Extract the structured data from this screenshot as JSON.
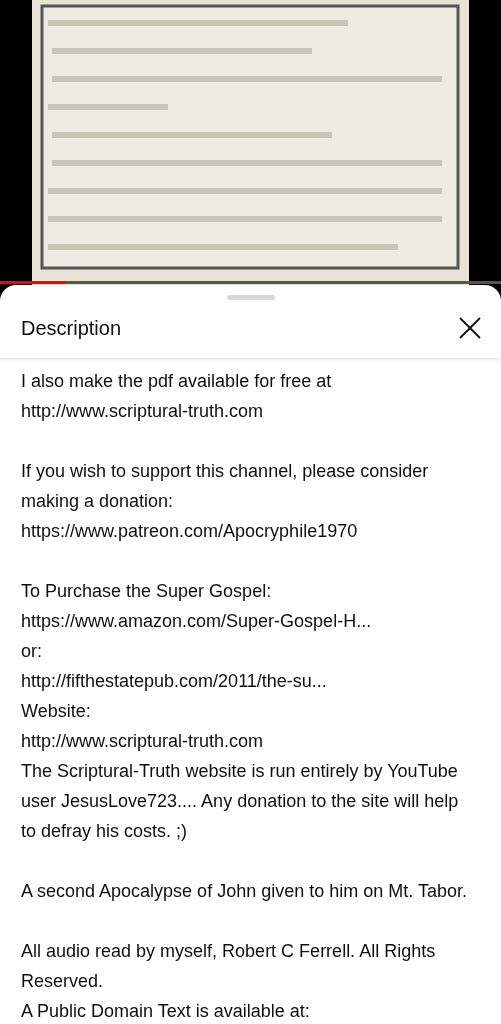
{
  "video": {
    "kind": "picture",
    "progress": {
      "level": 0.13
    }
  },
  "sheet": {
    "title": "Description",
    "paragraphs": [
      [
        "I also make the pdf available for free at",
        "http://www.scriptural-truth.com"
      ],
      [
        "If you wish to support this channel, please consider",
        "making a donation:",
        "https://www.patreon.com/Apocryphile1970"
      ],
      [
        "To Purchase the Super Gospel:",
        "https://www.amazon.com/Super-Gospel-H...",
        "or:",
        "http://fifthestatepub.com/2011/the-su...",
        "Website:",
        "http://www.scriptural-truth.com",
        "The Scriptural-Truth website is run entirely by YouTube",
        "user JesusLove723.... Any donation to the site will help",
        "to defray his costs. ;)"
      ],
      [
        "A second Apocalypse of John given to him on Mt. Tabor."
      ],
      [
        "All audio read by myself, Robert C Ferrell. All Rights",
        "Reserved.",
        "A Public Domain Text is available at:"
      ]
    ]
  }
}
